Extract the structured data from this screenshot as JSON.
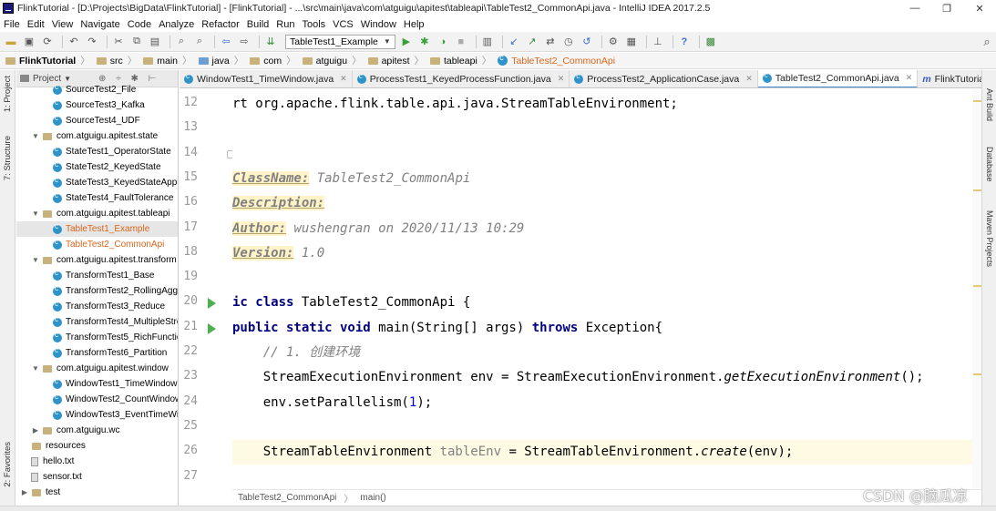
{
  "window": {
    "title": "FlinkTutorial - [D:\\Projects\\BigData\\FlinkTutorial] - [FlinkTutorial] - ...\\src\\main\\java\\com\\atguigu\\apitest\\tableapi\\TableTest2_CommonApi.java - IntelliJ IDEA 2017.2.5",
    "minimize": "—",
    "restore": "❐",
    "close": "✕"
  },
  "menu": [
    "File",
    "Edit",
    "View",
    "Navigate",
    "Code",
    "Analyze",
    "Refactor",
    "Build",
    "Run",
    "Tools",
    "VCS",
    "Window",
    "Help"
  ],
  "toolbar": {
    "run_config": "TableTest1_Example",
    "icons": [
      "open-icon",
      "save-icon",
      "sync-icon",
      "undo-icon",
      "redo-icon",
      "cut-icon",
      "copy-icon",
      "paste-icon",
      "find-icon",
      "replace-icon",
      "back-icon",
      "forward-icon",
      "build-icon",
      "run-icon",
      "debug-icon",
      "coverage-icon",
      "stop-icon",
      "structure-icon",
      "vcs-update-icon",
      "vcs-commit-icon",
      "compare-icon",
      "history-icon",
      "revert-icon",
      "settings-icon",
      "project-structure-icon",
      "sdk-icon",
      "help-icon",
      "plugin-icon",
      "search-everywhere-icon"
    ]
  },
  "navbar": {
    "crumbs": [
      "FlinkTutorial",
      "src",
      "main",
      "java",
      "com",
      "atguigu",
      "apitest",
      "tableapi",
      "TableTest2_CommonApi"
    ]
  },
  "left_strip": {
    "project": "1: Project",
    "structure": "7: Structure",
    "favorites": "2: Favorites"
  },
  "right_strip": {
    "ant": "Ant Build",
    "database": "Database",
    "maven": "Maven Projects"
  },
  "project_panel": {
    "header": "Project",
    "header_tools": "⊕ ÷ ✱ ⊢",
    "items": [
      {
        "label": "SourceTest2_File",
        "kind": "class",
        "indent": 3
      },
      {
        "label": "SourceTest3_Kafka",
        "kind": "class",
        "indent": 3
      },
      {
        "label": "SourceTest4_UDF",
        "kind": "class",
        "indent": 3
      },
      {
        "label": "com.atguigu.apitest.state",
        "kind": "package",
        "indent": 1
      },
      {
        "label": "StateTest1_OperatorState",
        "kind": "class",
        "indent": 3
      },
      {
        "label": "StateTest2_KeyedState",
        "kind": "class",
        "indent": 3
      },
      {
        "label": "StateTest3_KeyedStateApplication",
        "kind": "class",
        "indent": 3
      },
      {
        "label": "StateTest4_FaultTolerance",
        "kind": "class",
        "indent": 3
      },
      {
        "label": "com.atguigu.apitest.tableapi",
        "kind": "package",
        "indent": 1
      },
      {
        "label": "TableTest1_Example",
        "kind": "class-modified",
        "indent": 3,
        "selected": true
      },
      {
        "label": "TableTest2_CommonApi",
        "kind": "class-modified",
        "indent": 3
      },
      {
        "label": "com.atguigu.apitest.transform",
        "kind": "package",
        "indent": 1
      },
      {
        "label": "TransformTest1_Base",
        "kind": "class",
        "indent": 3
      },
      {
        "label": "TransformTest2_RollingAggregation",
        "kind": "class",
        "indent": 3
      },
      {
        "label": "TransformTest3_Reduce",
        "kind": "class",
        "indent": 3
      },
      {
        "label": "TransformTest4_MultipleStreams",
        "kind": "class",
        "indent": 3
      },
      {
        "label": "TransformTest5_RichFunction",
        "kind": "class",
        "indent": 3
      },
      {
        "label": "TransformTest6_Partition",
        "kind": "class",
        "indent": 3
      },
      {
        "label": "com.atguigu.apitest.window",
        "kind": "package",
        "indent": 1
      },
      {
        "label": "WindowTest1_TimeWindow",
        "kind": "class",
        "indent": 3
      },
      {
        "label": "WindowTest2_CountWindow",
        "kind": "class",
        "indent": 3
      },
      {
        "label": "WindowTest3_EventTimeWindow",
        "kind": "class",
        "indent": 3
      },
      {
        "label": "com.atguigu.wc",
        "kind": "package-collapsed",
        "indent": 1
      },
      {
        "label": "resources",
        "kind": "folder",
        "indent": 0
      },
      {
        "label": "hello.txt",
        "kind": "file",
        "indent": 1
      },
      {
        "label": "sensor.txt",
        "kind": "file",
        "indent": 1
      },
      {
        "label": "test",
        "kind": "folder-collapsed",
        "indent": 0
      }
    ]
  },
  "tabs": [
    {
      "label": "WindowTest1_TimeWindow.java",
      "kind": "class"
    },
    {
      "label": "ProcessTest1_KeyedProcessFunction.java",
      "kind": "class"
    },
    {
      "label": "ProcessTest2_ApplicationCase.java",
      "kind": "class"
    },
    {
      "label": "TableTest2_CommonApi.java",
      "kind": "class",
      "active": true
    },
    {
      "label": "FlinkTutorial",
      "kind": "maven"
    }
  ],
  "editor": {
    "lines": [
      {
        "no": "12",
        "text": "rt org.apache.flink.table.api.java.StreamTableEnvironment;"
      },
      {
        "no": "13",
        "text": ""
      },
      {
        "no": "14",
        "text": ""
      },
      {
        "no": "15",
        "doc_tag": "ClassName:",
        "doc_val": " TableTest2_CommonApi"
      },
      {
        "no": "16",
        "doc_tag": "Description:",
        "doc_val": ""
      },
      {
        "no": "17",
        "doc_tag": "Author:",
        "doc_val": " wushengran on 2020/11/13 10:29"
      },
      {
        "no": "18",
        "doc_tag": "Version:",
        "doc_val": " 1.0"
      },
      {
        "no": "19",
        "text": ""
      },
      {
        "no": "20",
        "kw": "ic class",
        "rest": " TableTest2_CommonApi {"
      },
      {
        "no": "21",
        "kw": "public static void",
        "rest": " main(String[] args) ",
        "kw2": "throws",
        "rest2": " Exception{"
      },
      {
        "no": "22",
        "comment": "    // 1. 创建环境"
      },
      {
        "no": "23",
        "pre": "    StreamExecutionEnvironment env = StreamExecutionEnvironment.",
        "italic": "getExecutionEnvironment",
        "post": "();"
      },
      {
        "no": "24",
        "pre": "    env.setParallelism(",
        "number": "1",
        "post": ");"
      },
      {
        "no": "25",
        "text": ""
      },
      {
        "no": "26",
        "pre": "    StreamTableEnvironment ",
        "unused": "tableEnv",
        "mid": " = StreamTableEnvironment.",
        "italic": "create",
        "post": "(env);",
        "current": true
      },
      {
        "no": "27",
        "text": ""
      }
    ]
  },
  "bottom_breadcrumb": {
    "class_name": "TableTest2_CommonApi",
    "method": "main()"
  },
  "watermark": "CSDN @脑瓜凉",
  "colors": {
    "keyword": "#000080",
    "doc_tag_bg": "#fff3c7",
    "comment": "#808080",
    "number": "#0000ff",
    "class_icon": "#2e93c9",
    "modified_file": "#d9661c",
    "run_marker": "#4caf50",
    "active_tab_border": "#4a90d9"
  }
}
